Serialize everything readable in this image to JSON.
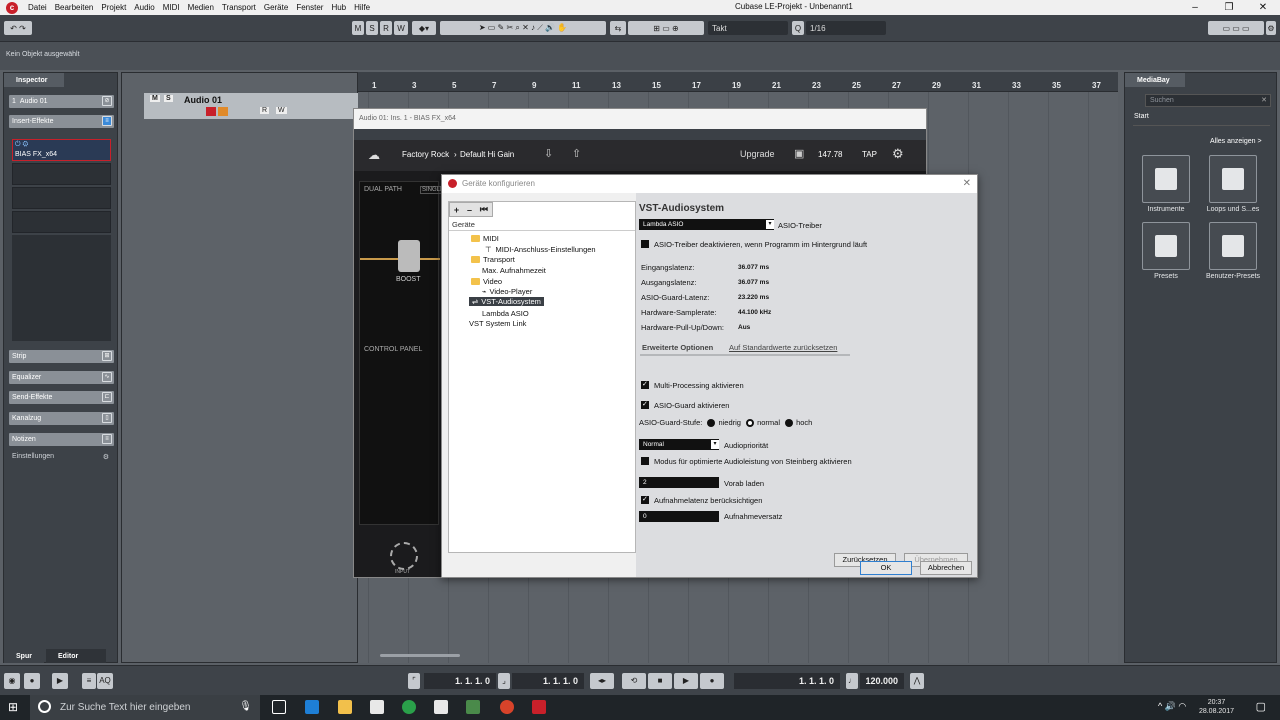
{
  "menubar": {
    "items": [
      "Datei",
      "Bearbeiten",
      "Projekt",
      "Audio",
      "MIDI",
      "Medien",
      "Transport",
      "Geräte",
      "Fenster",
      "Hub",
      "Hilfe"
    ],
    "window_title": "Cubase LE-Projekt - Unbenannt1"
  },
  "toolbar": {
    "m": "M",
    "s": "S",
    "r": "R",
    "w": "W",
    "grid_type": "Takt",
    "quantize": "1/16"
  },
  "status": {
    "selection": "Kein Objekt ausgewählt"
  },
  "inspector": {
    "tab": "Inspector",
    "track_name": "Audio 01",
    "track_number": "1",
    "insert_label": "Insert-Effekte",
    "insert_slot_1": "BIAS FX_x64",
    "sections": [
      "Strip",
      "Equalizer",
      "Send-Effekte",
      "Kanalzug",
      "Notizen"
    ],
    "settings": "Einstellungen",
    "bottom_tabs": [
      "Spur",
      "Editor"
    ]
  },
  "track": {
    "name": "Audio 01",
    "m": "M",
    "s": "S",
    "r": "R",
    "w": "W"
  },
  "ruler": {
    "ticks": [
      "1",
      "3",
      "5",
      "7",
      "9",
      "11",
      "13",
      "15",
      "17",
      "19",
      "21",
      "23",
      "25",
      "27",
      "29",
      "31",
      "33",
      "35",
      "37"
    ]
  },
  "mediabay": {
    "title": "MediaBay",
    "search_placeholder": "Suchen",
    "start": "Start",
    "show_all": "Alles anzeigen >",
    "tiles": [
      "Instrumente",
      "Loops und S...es",
      "Presets",
      "Benutzer-Presets"
    ]
  },
  "plugin": {
    "title": "Audio 01: Ins. 1 - BIAS FX_x64",
    "preset_path": "Factory Rock",
    "preset_name": "Default Hi Gain",
    "upgrade": "Upgrade",
    "bpm": "147.78",
    "tap": "TAP",
    "dual_path": "DUAL PATH",
    "single": "SINGLE",
    "boost": "BOOST",
    "control_panel": "CONTROL PANEL",
    "input": "INPUT"
  },
  "dialog": {
    "title": "Geräte konfigurieren",
    "tree_header": "Geräte",
    "tree": [
      {
        "label": "MIDI",
        "type": "folder"
      },
      {
        "label": "MIDI-Anschluss-Einstellungen",
        "type": "item"
      },
      {
        "label": "Transport",
        "type": "folder"
      },
      {
        "label": "Max. Aufnahmezeit",
        "type": "item"
      },
      {
        "label": "Video",
        "type": "folder"
      },
      {
        "label": "Video-Player",
        "type": "item"
      },
      {
        "label": "VST-Audiosystem",
        "type": "item"
      },
      {
        "label": "Lambda ASIO",
        "type": "item"
      },
      {
        "label": "VST System Link",
        "type": "item"
      }
    ],
    "heading": "VST-Audiosystem",
    "asio_driver_value": "Lambda ASIO",
    "asio_driver_label": "ASIO-Treiber",
    "deactivate_label": "ASIO-Treiber deaktivieren, wenn Programm im Hintergrund läuft",
    "latency": [
      {
        "label": "Eingangslatenz:",
        "value": "36.077 ms"
      },
      {
        "label": "Ausgangslatenz:",
        "value": "36.077 ms"
      },
      {
        "label": "ASIO-Guard-Latenz:",
        "value": "23.220 ms"
      },
      {
        "label": "Hardware-Samplerate:",
        "value": "44.100 kHz"
      },
      {
        "label": "Hardware-Pull-Up/Down:",
        "value": "Aus"
      }
    ],
    "advanced_tab": "Erweiterte Optionen",
    "reset_defaults": "Auf Standardwerte zurücksetzen",
    "multi_processing": "Multi-Processing aktivieren",
    "asio_guard": "ASIO-Guard aktivieren",
    "asio_guard_level_label": "ASIO-Guard-Stufe:",
    "levels": [
      "niedrig",
      "normal",
      "hoch"
    ],
    "audio_priority_value": "Normal",
    "audio_priority_label": "Audiopriorität",
    "optimized_mode": "Modus für optimierte Audioleistung von Steinberg aktivieren",
    "preload_value": "2",
    "preload_label": "Vorab laden",
    "rec_latency": "Aufnahmelatenz berücksichtigen",
    "rec_offset_value": "0",
    "rec_offset_label": "Aufnahmeversatz",
    "btn_reset": "Zurücksetzen",
    "btn_apply": "Übernehmen",
    "btn_ok": "OK",
    "btn_cancel": "Abbrechen"
  },
  "transport": {
    "left_locator": "1. 1. 1.   0",
    "right_locator": "1. 1. 1.   0",
    "position": "1. 1. 1.   0",
    "tempo": "120.000",
    "aq": "AQ"
  },
  "taskbar": {
    "search": "Zur Suche Text hier eingeben",
    "time": "20:37",
    "date": "28.08.2017"
  }
}
